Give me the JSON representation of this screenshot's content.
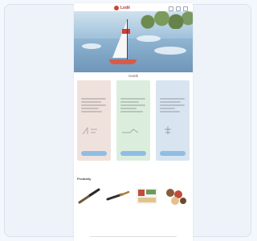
{
  "header": {
    "logo_text": "Lodě"
  },
  "hero": {
    "section_title": "Ceník"
  },
  "offers": [
    {
      "kicker": "",
      "title": "",
      "button_label": ""
    },
    {
      "kicker": "",
      "title": "",
      "button_label": ""
    },
    {
      "kicker": "",
      "title": "",
      "button_label": ""
    }
  ],
  "products": {
    "title": "Produkty",
    "items": [
      {
        "name": "",
        "price": ""
      },
      {
        "name": "",
        "price": ""
      },
      {
        "name": "",
        "price": ""
      },
      {
        "name": "",
        "price": ""
      }
    ]
  },
  "colors": {
    "offer_1_bg": "#efe2dc",
    "offer_2_bg": "#dbeedd",
    "offer_3_bg": "#d8e5f0",
    "button": "#8fbde3",
    "accent_green": "#2d9a52"
  }
}
